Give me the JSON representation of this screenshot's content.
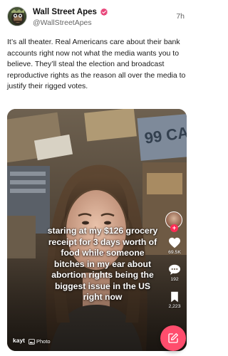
{
  "post": {
    "author": {
      "display_name": "Wall Street Apes",
      "handle": "@WallStreetApes",
      "verified": true,
      "avatar_icon": "ape-avatar"
    },
    "timestamp": "7h",
    "text": "It’s all theater. Real Americans care about their bank accounts right now not what the media wants you to believe. They’ll steal the election and broadcast reproductive rights as the reason all over the media to justify their rigged votes.",
    "media": {
      "caption": "staring at my $126 grocery receipt for 3 days worth of food while someone bitches in my ear about abortion rights being the biggest issue in the US right now",
      "creator": "kayt",
      "type_label": "Photo",
      "rail": {
        "likes": "69.5K",
        "comments": "192",
        "saves": "2,223"
      }
    },
    "compose_button_icon": "compose-icon"
  },
  "colors": {
    "verified_badge": "#e8457a",
    "fab": "#ff4d6d",
    "follow_plus": "#fe2c55"
  }
}
